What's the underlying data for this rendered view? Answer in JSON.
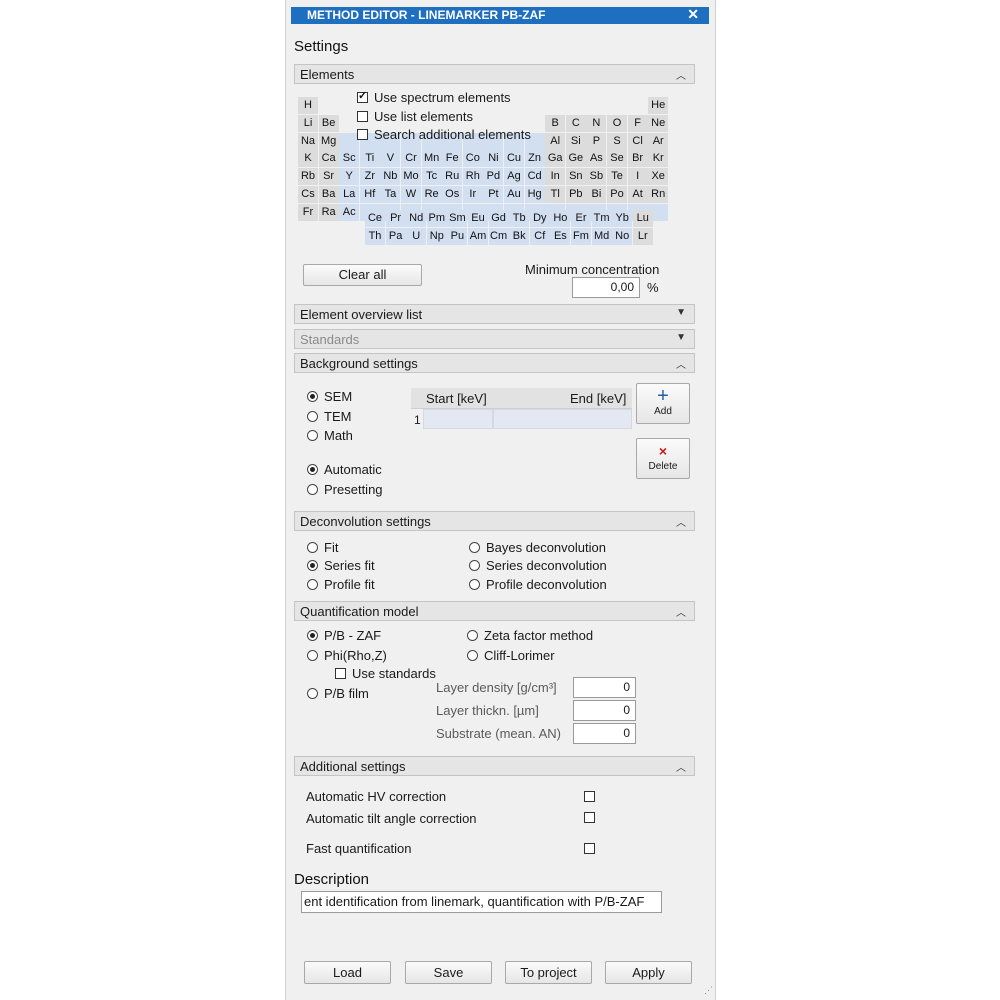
{
  "window": {
    "title": "METHOD EDITOR - LINEMARKER PB-ZAF",
    "close_symbol": "✕"
  },
  "settings_heading": "Settings",
  "elements": {
    "header": "Elements",
    "options": [
      {
        "label": "Use spectrum elements",
        "checked": true
      },
      {
        "label": "Use list elements",
        "checked": false
      },
      {
        "label": "Search additional elements",
        "checked": false
      }
    ],
    "table_rows": [
      [
        "H",
        "",
        "",
        "",
        "",
        "",
        "",
        "",
        "",
        "",
        "",
        "",
        "",
        "",
        "",
        "",
        "",
        "He"
      ],
      [
        "Li",
        "Be",
        "",
        "",
        "",
        "",
        "",
        "",
        "",
        "",
        "",
        "",
        "B",
        "C",
        "N",
        "O",
        "F",
        "Ne"
      ],
      [
        "Na",
        "Mg",
        "",
        "",
        "",
        "",
        "",
        "",
        "",
        "",
        "",
        "",
        "Al",
        "Si",
        "P",
        "S",
        "Cl",
        "Ar"
      ],
      [
        "K",
        "Ca",
        "Sc",
        "Ti",
        "V",
        "Cr",
        "Mn",
        "Fe",
        "Co",
        "Ni",
        "Cu",
        "Zn",
        "Ga",
        "Ge",
        "As",
        "Se",
        "Br",
        "Kr"
      ],
      [
        "Rb",
        "Sr",
        "Y",
        "Zr",
        "Nb",
        "Mo",
        "Tc",
        "Ru",
        "Rh",
        "Pd",
        "Ag",
        "Cd",
        "In",
        "Sn",
        "Sb",
        "Te",
        "I",
        "Xe"
      ],
      [
        "Cs",
        "Ba",
        "La",
        "Hf",
        "Ta",
        "W",
        "Re",
        "Os",
        "Ir",
        "Pt",
        "Au",
        "Hg",
        "Tl",
        "Pb",
        "Bi",
        "Po",
        "At",
        "Rn"
      ],
      [
        "Fr",
        "Ra",
        "Ac",
        "",
        "",
        "",
        "",
        "",
        "",
        "",
        "",
        "",
        "",
        "",
        "",
        "",
        "",
        ""
      ]
    ],
    "lanthanides": [
      "Ce",
      "Pr",
      "Nd",
      "Pm",
      "Sm",
      "Eu",
      "Gd",
      "Tb",
      "Dy",
      "Ho",
      "Er",
      "Tm",
      "Yb",
      "Lu"
    ],
    "actinides": [
      "Th",
      "Pa",
      "U",
      "Np",
      "Pu",
      "Am",
      "Cm",
      "Bk",
      "Cf",
      "Es",
      "Fm",
      "Md",
      "No",
      "Lr"
    ],
    "clear_all": "Clear all",
    "min_conc_label": "Minimum concentration",
    "min_conc_value": "0,00",
    "min_conc_unit": "%"
  },
  "element_overview": {
    "header": "Element overview list"
  },
  "standards": {
    "header": "Standards"
  },
  "background": {
    "header": "Background settings",
    "mode_options": [
      {
        "label": "SEM",
        "checked": true
      },
      {
        "label": "TEM",
        "checked": false
      },
      {
        "label": "Math",
        "checked": false
      }
    ],
    "method_options": [
      {
        "label": "Automatic",
        "checked": true
      },
      {
        "label": "Presetting",
        "checked": false
      }
    ],
    "table": {
      "col_start": "Start [keV]",
      "col_end": "End [keV]",
      "row_index": "1"
    },
    "add_label": "Add",
    "delete_label": "Delete"
  },
  "deconvolution": {
    "header": "Deconvolution settings",
    "left": [
      {
        "label": "Fit",
        "checked": false
      },
      {
        "label": "Series fit",
        "checked": true
      },
      {
        "label": "Profile fit",
        "checked": false
      }
    ],
    "right": [
      {
        "label": "Bayes deconvolution",
        "checked": false
      },
      {
        "label": "Series deconvolution",
        "checked": false
      },
      {
        "label": "Profile deconvolution",
        "checked": false
      }
    ]
  },
  "quantification": {
    "header": "Quantification model",
    "pb_zaf": "P/B - ZAF",
    "phi_rho_z": "Phi(Rho,Z)",
    "zeta": "Zeta factor method",
    "cliff": "Cliff-Lorimer",
    "use_standards": "Use standards",
    "pb_film": "P/B film",
    "layer_density_label": "Layer density [g/cm³]",
    "layer_density_value": "0",
    "layer_thickness_label": "Layer thickn. [µm]",
    "layer_thickness_value": "0",
    "substrate_label": "Substrate (mean. AN)",
    "substrate_value": "0"
  },
  "additional": {
    "header": "Additional settings",
    "hv": "Automatic HV correction",
    "tilt": "Automatic tilt angle correction",
    "fast": "Fast quantification"
  },
  "description": {
    "label": "Description",
    "value": "ent identification from linemark, quantification with P/B-ZAF"
  },
  "footer": {
    "load": "Load",
    "save": "Save",
    "to_project": "To project",
    "apply": "Apply"
  }
}
